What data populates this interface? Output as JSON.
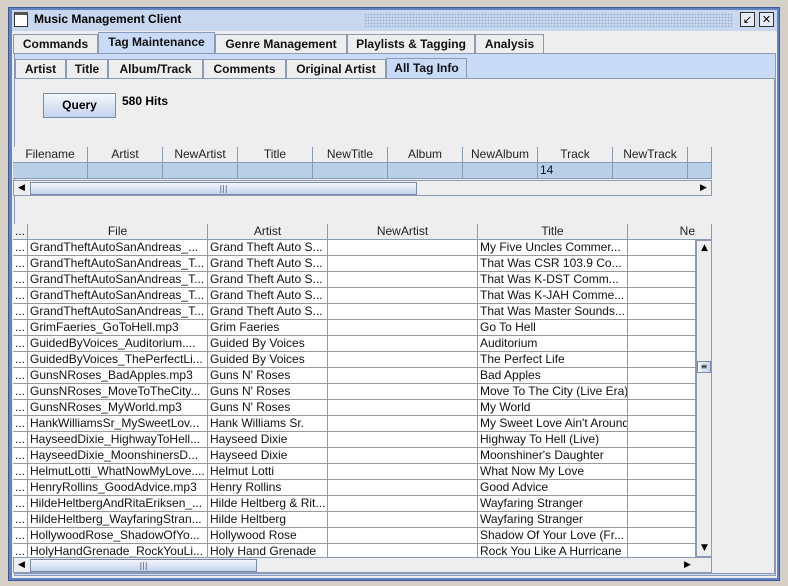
{
  "window": {
    "title": "Music Management Client",
    "minimize_icon": "restore-icon",
    "close_icon": "close-icon"
  },
  "main_tabs": [
    {
      "label": "Commands"
    },
    {
      "label": "Tag Maintenance",
      "selected": true
    },
    {
      "label": "Genre Management"
    },
    {
      "label": "Playlists & Tagging"
    },
    {
      "label": "Analysis"
    }
  ],
  "sub_tabs": [
    {
      "label": "Artist"
    },
    {
      "label": "Title"
    },
    {
      "label": "Album/Track"
    },
    {
      "label": "Comments"
    },
    {
      "label": "Original Artist"
    },
    {
      "label": "All Tag Info",
      "selected": true
    }
  ],
  "query": {
    "button": "Query",
    "hits": "580 Hits"
  },
  "top_table": {
    "columns": [
      "Filename",
      "Artist",
      "NewArtist",
      "Title",
      "NewTitle",
      "Album",
      "NewAlbum",
      "Track",
      "NewTrack",
      ""
    ],
    "row": [
      "",
      "",
      "",
      "",
      "",
      "",
      "",
      "14",
      "",
      ""
    ]
  },
  "files_table": {
    "columns": [
      "...",
      "File",
      "Artist",
      "NewArtist",
      "Title",
      "Ne"
    ],
    "rows": [
      [
        "...",
        "GrandTheftAutoSanAndreas_...",
        "Grand Theft Auto S...",
        "",
        "My Five Uncles Commer...",
        ""
      ],
      [
        "...",
        "GrandTheftAutoSanAndreas_T...",
        "Grand Theft Auto S...",
        "",
        "That Was CSR 103.9 Co...",
        ""
      ],
      [
        "...",
        "GrandTheftAutoSanAndreas_T...",
        "Grand Theft Auto S...",
        "",
        "That Was K-DST Comm...",
        ""
      ],
      [
        "...",
        "GrandTheftAutoSanAndreas_T...",
        "Grand Theft Auto S...",
        "",
        "That Was K-JAH Comme...",
        ""
      ],
      [
        "...",
        "GrandTheftAutoSanAndreas_T...",
        "Grand Theft Auto S...",
        "",
        "That Was Master Sounds...",
        ""
      ],
      [
        "...",
        "GrimFaeries_GoToHell.mp3",
        "Grim Faeries",
        "",
        "Go To Hell",
        ""
      ],
      [
        "...",
        "GuidedByVoices_Auditorium....",
        "Guided By Voices",
        "",
        "Auditorium",
        ""
      ],
      [
        "...",
        "GuidedByVoices_ThePerfectLi...",
        "Guided By Voices",
        "",
        "The Perfect Life",
        ""
      ],
      [
        "...",
        "GunsNRoses_BadApples.mp3",
        "Guns N' Roses",
        "",
        "Bad Apples",
        ""
      ],
      [
        "...",
        "GunsNRoses_MoveToTheCity...",
        "Guns N' Roses",
        "",
        "Move To The City (Live Era)",
        ""
      ],
      [
        "...",
        "GunsNRoses_MyWorld.mp3",
        "Guns N' Roses",
        "",
        "My World",
        ""
      ],
      [
        "...",
        "HankWilliamsSr_MySweetLov...",
        "Hank Williams Sr.",
        "",
        "My Sweet Love Ain't Around",
        ""
      ],
      [
        "...",
        "HayseedDixie_HighwayToHell...",
        "Hayseed Dixie",
        "",
        "Highway To Hell (Live)",
        ""
      ],
      [
        "...",
        "HayseedDixie_MoonshinersD...",
        "Hayseed Dixie",
        "",
        "Moonshiner's Daughter",
        ""
      ],
      [
        "...",
        "HelmutLotti_WhatNowMyLove....",
        "Helmut Lotti",
        "",
        "What Now My Love",
        ""
      ],
      [
        "...",
        "HenryRollins_GoodAdvice.mp3",
        "Henry Rollins",
        "",
        "Good Advice",
        ""
      ],
      [
        "...",
        "HildeHeltbergAndRitaEriksen_...",
        "Hilde Heltberg & Rit...",
        "",
        "Wayfaring Stranger",
        ""
      ],
      [
        "...",
        "HildeHeltberg_WayfaringStran...",
        "Hilde Heltberg",
        "",
        "Wayfaring Stranger",
        ""
      ],
      [
        "...",
        "HollywoodRose_ShadowOfYo...",
        "Hollywood Rose",
        "",
        "Shadow Of Your Love (Fr...",
        ""
      ],
      [
        "...",
        "HolyHandGrenade_RockYouLi...",
        "Holy Hand Grenade",
        "",
        "Rock You Like A Hurricane",
        ""
      ]
    ]
  }
}
